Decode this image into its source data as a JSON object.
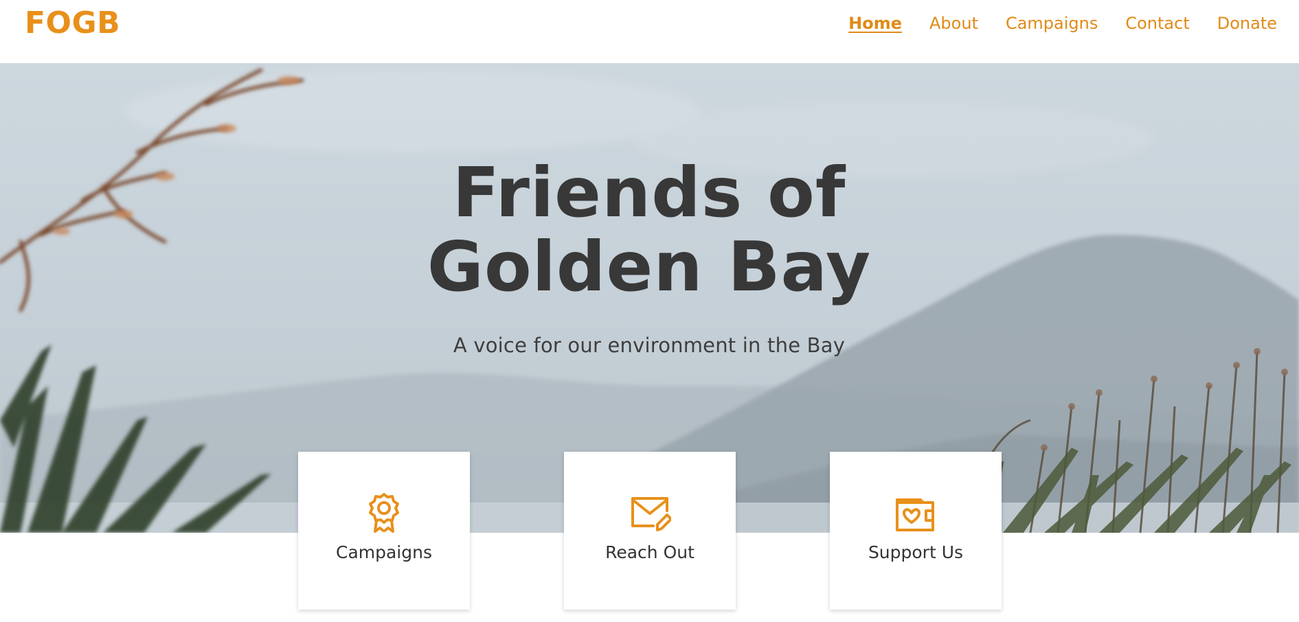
{
  "header": {
    "logo": "FOGB",
    "nav": [
      {
        "label": "Home",
        "active": true
      },
      {
        "label": "About",
        "active": false
      },
      {
        "label": "Campaigns",
        "active": false
      },
      {
        "label": "Contact",
        "active": false
      },
      {
        "label": "Donate",
        "active": false
      }
    ]
  },
  "hero": {
    "title_line1": "Friends of",
    "title_line2": "Golden Bay",
    "subtitle": "A voice for our environment in the Bay"
  },
  "cards": [
    {
      "label": "Campaigns",
      "icon": "award-ribbon-icon"
    },
    {
      "label": "Reach Out",
      "icon": "mail-edit-icon"
    },
    {
      "label": "Support Us",
      "icon": "wallet-heart-icon"
    }
  ],
  "colors": {
    "accent": "#e8901a",
    "text_dark": "#383838",
    "sky": "#cfd8df"
  }
}
